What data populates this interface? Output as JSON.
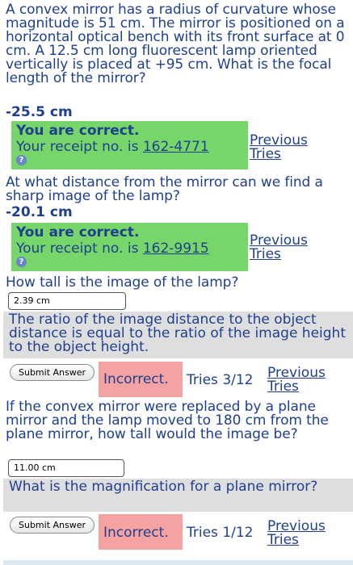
{
  "q1": {
    "question": "A convex mirror has a radius of curvature whose magnitude is 51 cm. The mirror is positioned on a horizontal optical bench with its front surface at 0 cm. A 12.5 cm long fluorescent lamp oriented vertically is placed at +95 cm. What is the focal length of the mirror?",
    "answer": "-25.5 cm",
    "status": "You are correct.",
    "receipt_prefix": "Your receipt no. is ",
    "receipt": "162-4771",
    "previous_tries": "Previous Tries",
    "help_icon": "?"
  },
  "q2": {
    "question": "At what distance from the mirror can we find a sharp image of the lamp?",
    "answer": "-20.1 cm",
    "status": "You are correct.",
    "receipt_prefix": "Your receipt no. is ",
    "receipt": "162-9915",
    "previous_tries": "Previous Tries",
    "help_icon": "?"
  },
  "q3": {
    "question": "How tall is the image of the lamp?",
    "input_value": "2.39 cm",
    "hint": "The ratio of the image distance to the object distance is equal to the ratio of the image height to the object height.",
    "submit_label": "Submit Answer",
    "result": "Incorrect.",
    "tries": "Tries 3/12",
    "previous_tries": "Previous Tries"
  },
  "q4": {
    "question": "If the convex mirror were replaced by a plane mirror and the lamp moved to 180 cm from the plane mirror, how tall would the image be?",
    "input_value": "11.00 cm",
    "hint": "What is the magnification for a plane mirror?",
    "submit_label": "Submit Answer",
    "result": "Incorrect.",
    "tries": "Tries 1/12",
    "previous_tries": "Previous Tries"
  },
  "colors": {
    "text": "#1f3f8f",
    "correct_bg": "#77d669",
    "incorrect_bg": "#f4a2a2",
    "hint_bg": "#dedede"
  }
}
